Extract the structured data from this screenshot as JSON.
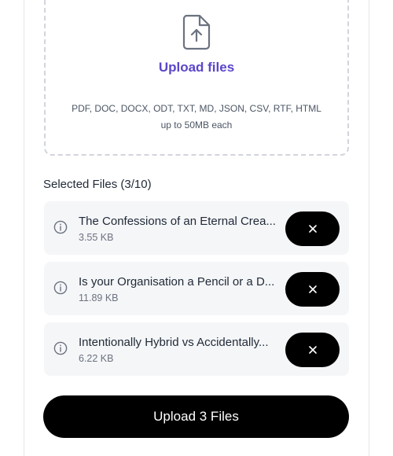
{
  "dropzone": {
    "title": "Upload files",
    "types_line": "PDF, DOC, DOCX, ODT, TXT, MD, JSON, CSV, RTF, HTML",
    "size_line": "up to 50MB each",
    "icon": "file-upload-icon"
  },
  "selected": {
    "title": "Selected Files (3/10)",
    "files": [
      {
        "name": "The Confessions of an Eternal Crea...",
        "size": "3.55 KB"
      },
      {
        "name": "Is your Organisation a Pencil or a D...",
        "size": "11.89 KB"
      },
      {
        "name": "Intentionally Hybrid vs Accidentally...",
        "size": "6.22 KB"
      }
    ]
  },
  "actions": {
    "upload_label": "Upload 3 Files"
  },
  "colors": {
    "accent": "#5b47c8",
    "button": "#000000",
    "row_bg": "#f5f6f8"
  }
}
